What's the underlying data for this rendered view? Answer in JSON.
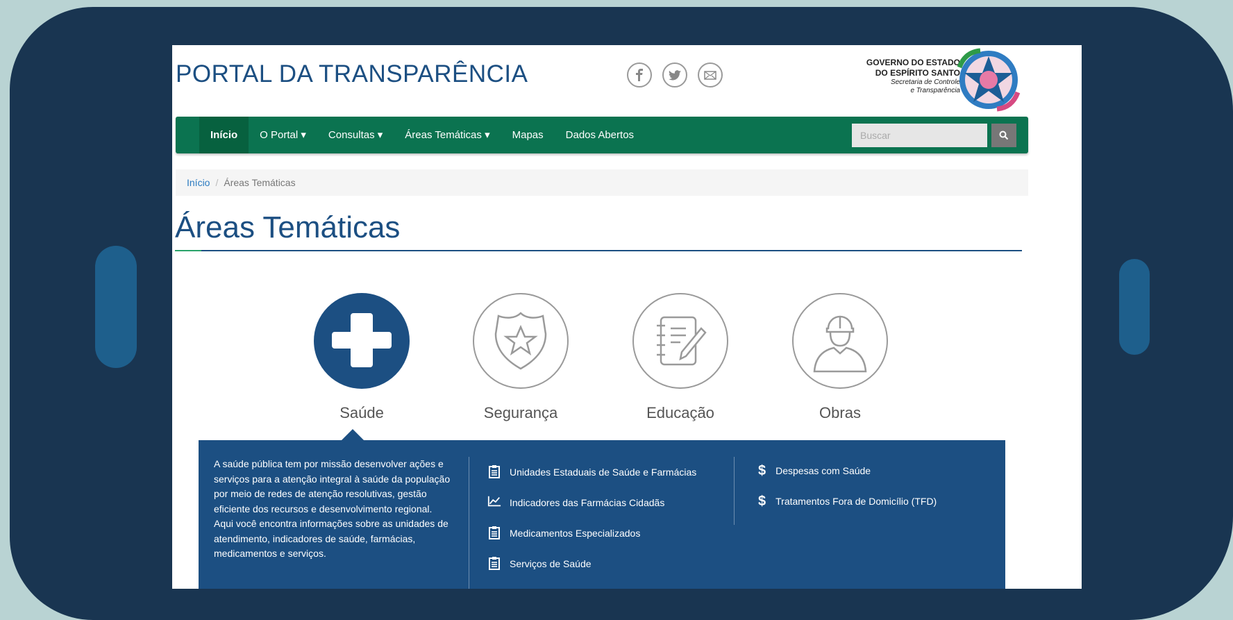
{
  "header": {
    "site_title": "PORTAL DA TRANSPARÊNCIA",
    "gov_line1": "GOVERNO DO ESTADO",
    "gov_line2": "DO ESPÍRITO SANTO",
    "gov_line3": "Secretaria de Controle",
    "gov_line4": "e Transparência",
    "social_icons": [
      "facebook-icon",
      "twitter-icon",
      "email-icon"
    ]
  },
  "nav": {
    "items": [
      {
        "label": "Início",
        "active": true
      },
      {
        "label": "O Portal ▾"
      },
      {
        "label": "Consultas ▾"
      },
      {
        "label": "Áreas Temáticas ▾"
      },
      {
        "label": "Mapas"
      },
      {
        "label": "Dados Abertos"
      }
    ],
    "search_placeholder": "Buscar"
  },
  "breadcrumb": {
    "home": "Início",
    "separator": "/",
    "current": "Áreas Temáticas"
  },
  "page": {
    "title": "Áreas Temáticas"
  },
  "themes": [
    {
      "label": "Saúde",
      "icon": "plus-icon",
      "active": true
    },
    {
      "label": "Segurança",
      "icon": "badge-icon"
    },
    {
      "label": "Educação",
      "icon": "notebook-icon"
    },
    {
      "label": "Obras",
      "icon": "worker-icon"
    }
  ],
  "panel": {
    "description": "A saúde pública tem por missão desenvolver ações e serviços para a atenção integral à saúde da população por meio de redes de atenção resolutivas, gestão eficiente dos recursos e desenvolvimento regional. Aqui você encontra informações sobre as unidades de atendimento, indicadores de saúde, farmácias, medicamentos e serviços.",
    "links_col1": [
      {
        "label": "Unidades Estaduais de Saúde e Farmácias",
        "icon": "clipboard-icon"
      },
      {
        "label": "Indicadores das Farmácias Cidadãs",
        "icon": "line-chart-icon"
      },
      {
        "label": "Medicamentos Especializados",
        "icon": "clipboard-icon"
      },
      {
        "label": "Serviços de Saúde",
        "icon": "clipboard-icon"
      }
    ],
    "links_col2": [
      {
        "label": "Despesas com Saúde",
        "icon": "dollar-icon"
      },
      {
        "label": "Tratamentos Fora de Domicílio (TFD)",
        "icon": "dollar-icon"
      }
    ]
  },
  "colors": {
    "brand_blue": "#1c4f82",
    "nav_green": "#0b7350",
    "frame": "#193551",
    "background": "#b9d3d3"
  }
}
